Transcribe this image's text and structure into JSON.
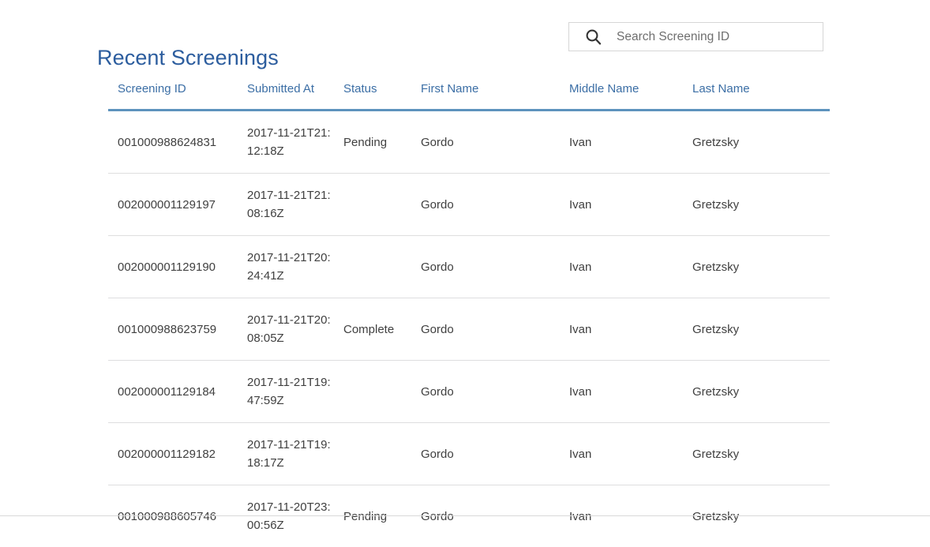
{
  "header": {
    "title": "Recent Screenings"
  },
  "search": {
    "icon": "search-icon",
    "placeholder": "Search Screening ID",
    "value": ""
  },
  "table": {
    "columns": [
      {
        "key": "screening_id",
        "label": "Screening ID"
      },
      {
        "key": "submitted_at",
        "label": "Submitted At"
      },
      {
        "key": "status",
        "label": "Status"
      },
      {
        "key": "first_name",
        "label": "First Name"
      },
      {
        "key": "middle_name",
        "label": "Middle Name"
      },
      {
        "key": "last_name",
        "label": "Last Name"
      }
    ],
    "rows": [
      {
        "screening_id": "001000988624831",
        "submitted_at": "2017-11-21T21:12:18Z",
        "status": "Pending",
        "first_name": "Gordo",
        "middle_name": "Ivan",
        "last_name": "Gretzsky"
      },
      {
        "screening_id": "002000001129197",
        "submitted_at": "2017-11-21T21:08:16Z",
        "status": "",
        "first_name": "Gordo",
        "middle_name": "Ivan",
        "last_name": "Gretzsky"
      },
      {
        "screening_id": "002000001129190",
        "submitted_at": "2017-11-21T20:24:41Z",
        "status": "",
        "first_name": "Gordo",
        "middle_name": "Ivan",
        "last_name": "Gretzsky"
      },
      {
        "screening_id": "001000988623759",
        "submitted_at": "2017-11-21T20:08:05Z",
        "status": "Complete",
        "first_name": "Gordo",
        "middle_name": "Ivan",
        "last_name": "Gretzsky"
      },
      {
        "screening_id": "002000001129184",
        "submitted_at": "2017-11-21T19:47:59Z",
        "status": "",
        "first_name": "Gordo",
        "middle_name": "Ivan",
        "last_name": "Gretzsky"
      },
      {
        "screening_id": "002000001129182",
        "submitted_at": "2017-11-21T19:18:17Z",
        "status": "",
        "first_name": "Gordo",
        "middle_name": "Ivan",
        "last_name": "Gretzsky"
      },
      {
        "screening_id": "001000988605746",
        "submitted_at": "2017-11-20T23:00:56Z",
        "status": "Pending",
        "first_name": "Gordo",
        "middle_name": "Ivan",
        "last_name": "Gretzsky"
      }
    ]
  },
  "colors": {
    "title_blue": "#2c5d9e",
    "header_blue": "#3b6ea5",
    "header_rule": "#5d93bd",
    "row_rule": "#dededf",
    "text": "#404040",
    "border": "#d6d6d6"
  }
}
